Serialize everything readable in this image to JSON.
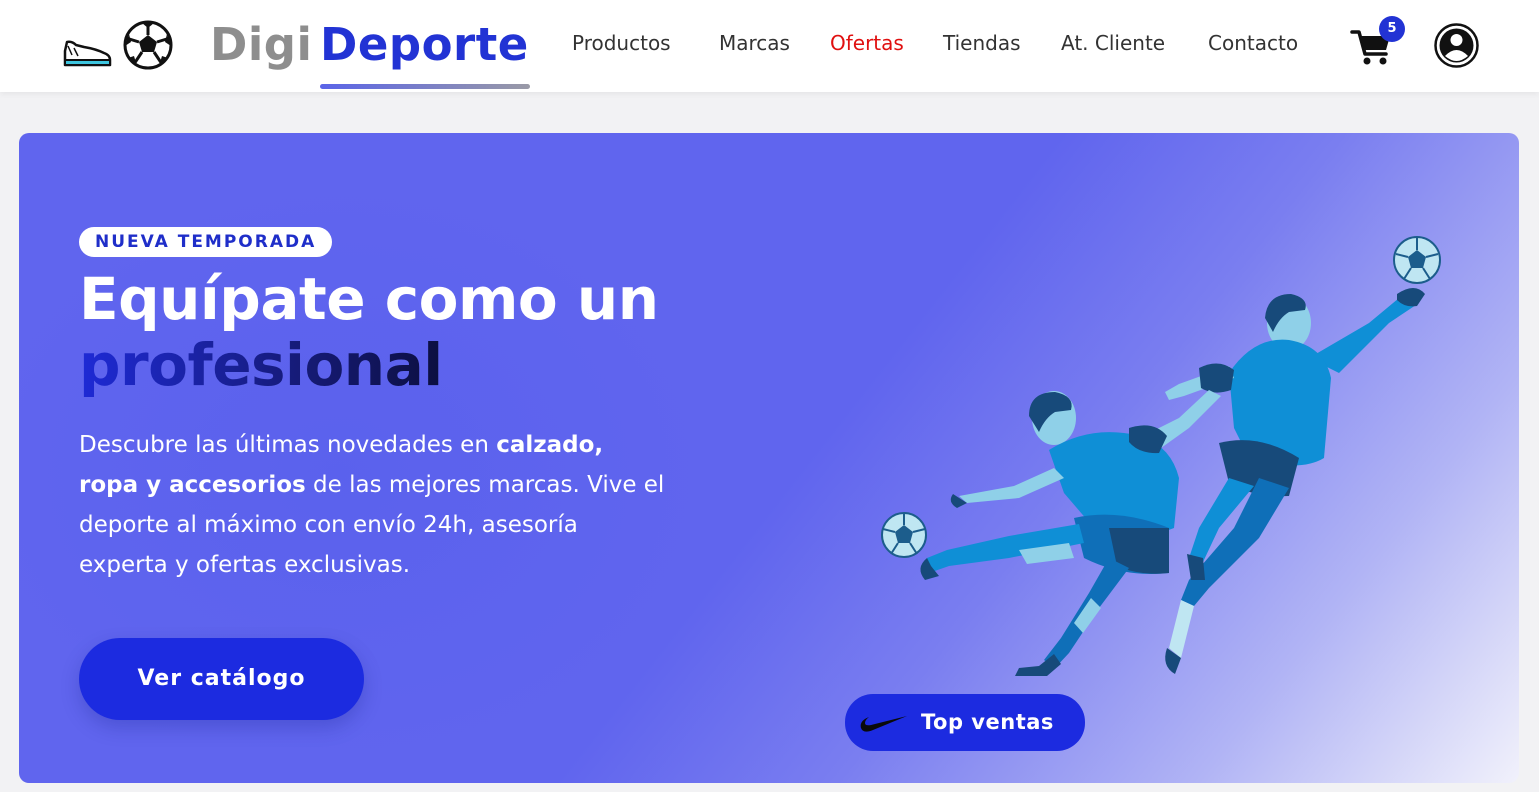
{
  "header": {
    "brand_part1": "Digi",
    "brand_part2": "Deporte",
    "nav": [
      {
        "label": "Productos"
      },
      {
        "label": "Marcas"
      },
      {
        "label": "Ofertas"
      },
      {
        "label": "Tiendas"
      },
      {
        "label": "At. Cliente"
      },
      {
        "label": "Contacto"
      }
    ],
    "cart_count": "5",
    "icons": [
      "sneaker-icon",
      "soccer-ball-icon",
      "cart-icon",
      "user-icon"
    ]
  },
  "hero": {
    "badge": "NUEVA TEMPORADA",
    "headline_line1": "Equípate como un",
    "headline_line2": "profesional",
    "desc": {
      "t1": "Descubre las últimas novedades en ",
      "b1": "calzado, ropa y accesorios",
      "t2": " de las mejores marcas. Vive el deporte al máximo con envío 24h, asesoría experta y ofertas exclusivas."
    },
    "cta_label": "Ver catálogo",
    "top_sales_label": "Top ventas",
    "illustration": "soccer-players-illustration"
  },
  "colors": {
    "brand_blue": "#2233d4",
    "brand_gray": "#8e8e8e",
    "offer_red": "#e01010",
    "hero_bg": "#6065ee",
    "button_blue": "#1c2be0"
  }
}
